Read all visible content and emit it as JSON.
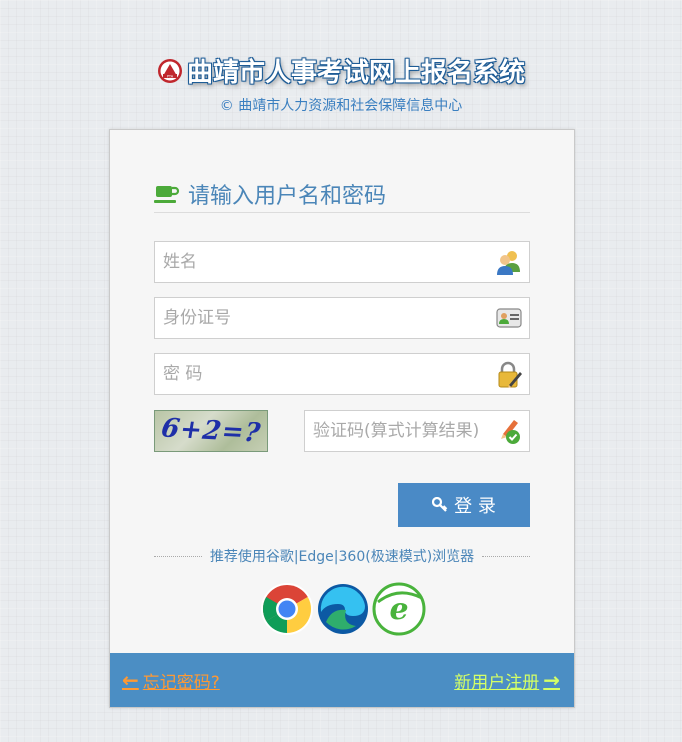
{
  "header": {
    "title": "曲靖市人事考试网上报名系统",
    "copyright": "© 曲靖市人力资源和社会保障信息中心"
  },
  "panel": {
    "heading": "请输入用户名和密码",
    "name_placeholder": "姓名",
    "id_placeholder": "身份证号",
    "password_placeholder": "密 码",
    "captcha_text": "6+2=?",
    "captcha_placeholder": "验证码(算式计算结果)",
    "login_label": "登 录",
    "recommend_text": "推荐使用谷歌|Edge|360(极速模式)浏览器"
  },
  "browsers": [
    {
      "icon": "chrome-icon"
    },
    {
      "icon": "edge-icon"
    },
    {
      "icon": "360-browser-icon"
    }
  ],
  "footer": {
    "forgot_label": "忘记密码?",
    "register_label": "新用户注册"
  },
  "colors": {
    "accent": "#4a8ac6",
    "footer_bg": "#4b8ec4",
    "forgot": "#ff9933",
    "register": "#d4ff66"
  }
}
